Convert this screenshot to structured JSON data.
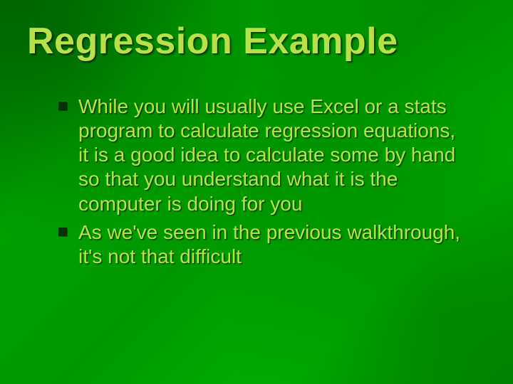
{
  "slide": {
    "title": "Regression Example",
    "bullets": [
      "While you will usually use Excel or a stats program to calculate regression equations, it is a good idea to calculate some by hand so that you understand what it is the computer is doing for you",
      "As we've seen in the previous walkthrough, it's not that difficult"
    ]
  }
}
